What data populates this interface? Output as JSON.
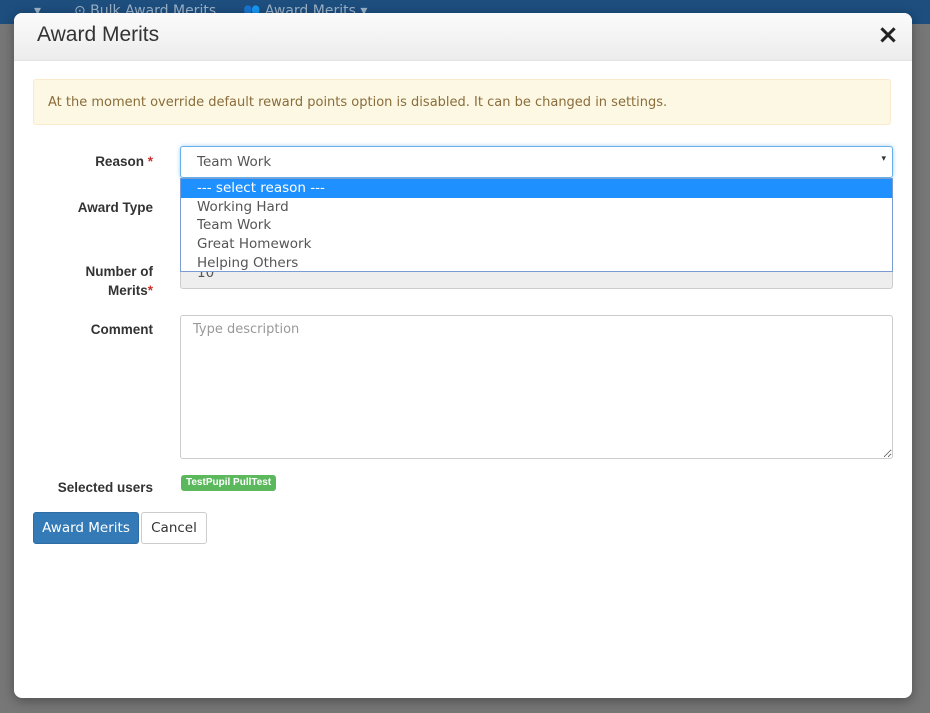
{
  "background": {
    "tabs": [
      {
        "label": "▾"
      },
      {
        "label": "⊙ Bulk Award Merits"
      },
      {
        "label": "👥 Award Merits ▾"
      }
    ]
  },
  "modal": {
    "title": "Award Merits",
    "close_icon": "×",
    "alert": "At the moment override default reward points option is disabled. It can be changed in settings.",
    "reason": {
      "label": "Reason",
      "required_mark": "*",
      "selected": "Team Work",
      "caret": "▾",
      "options": [
        "--- select reason ---",
        "Working Hard",
        "Team Work",
        "Great Homework",
        "Helping Others"
      ]
    },
    "award_type": {
      "label": "Award Type"
    },
    "number_of_merits": {
      "label_line1": "Number of",
      "label_line2": "Merits",
      "required_mark": "*",
      "value": "10"
    },
    "comment": {
      "label": "Comment",
      "placeholder": "Type description"
    },
    "selected_users": {
      "label": "Selected users",
      "users": [
        "TestPupil PullTest"
      ]
    },
    "buttons": {
      "award": "Award Merits",
      "cancel": "Cancel"
    }
  }
}
